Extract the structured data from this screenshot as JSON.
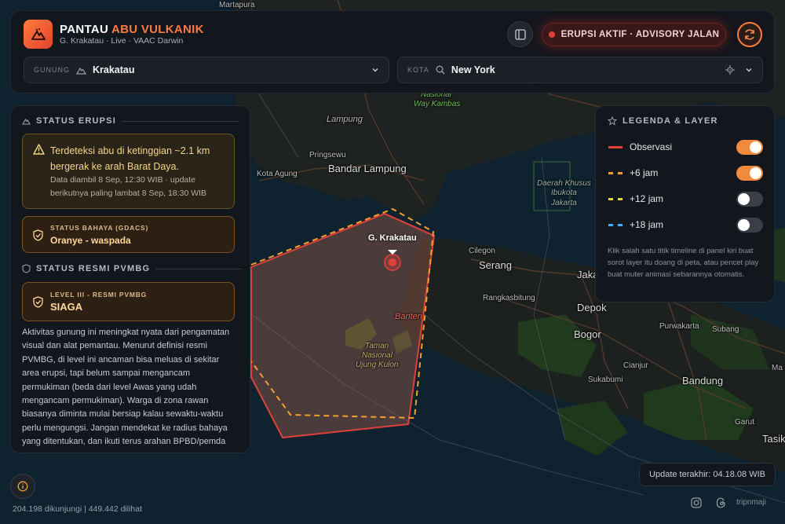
{
  "header": {
    "title_main": "PANTAU",
    "title_accent": "ABU VULKANIK",
    "subtitle": "G. Krakatau · Live · VAAC Darwin",
    "status_pill": "ERUPSI AKTIF · ADVISORY JALAN",
    "volcano_selector": {
      "label": "GUNUNG",
      "value": "Krakatau"
    },
    "city_selector": {
      "label": "KOTA",
      "value": "New York"
    }
  },
  "status_erupsi": {
    "title": "STATUS ERUPSI",
    "alert_main": "Terdeteksi abu di ketinggian ~2.1 km bergerak ke arah Barat Daya.",
    "alert_sub": "Data diambil 8 Sep, 12:30 WIB · update berikutnya paling lambat 8 Sep, 18:30 WIB",
    "gdacs_label": "STATUS BAHAYA (GDACS)",
    "gdacs_value": "Oranye - waspada"
  },
  "status_pvmbg": {
    "title": "STATUS RESMI PVMBG",
    "level_label": "LEVEL III - RESMI PVMBG",
    "level_value": "SIAGA",
    "description": "Aktivitas gunung ini meningkat nyata dari pengamatan visual dan alat pemantau. Menurut definisi resmi PVMBG, di level ini ancaman bisa meluas di sekitar area erupsi, tapi belum sampai mengancam permukiman (beda dari level Awas yang udah mengancam permukiman). Warga di zona rawan biasanya diminta mulai bersiap kalau sewaktu-waktu perlu mengungsi. Jangan mendekat ke radius bahaya yang ditentukan, dan ikuti terus arahan BPBD/pemda setempat."
  },
  "legend": {
    "title": "LEGENDA & LAYER",
    "items": [
      {
        "label": "Observasi",
        "color": "#e0403a",
        "style": "solid",
        "enabled": true
      },
      {
        "label": "+6 jam",
        "color": "#f0a030",
        "style": "dashed",
        "enabled": true
      },
      {
        "label": "+12 jam",
        "color": "#f2d23a",
        "style": "dashed",
        "enabled": false
      },
      {
        "label": "+18 jam",
        "color": "#4aa8f0",
        "style": "dashed",
        "enabled": false
      }
    ],
    "note": "Klik salah satu titik timeline di panel kiri buat sorot layer itu doang di peta, atau pencet play buat muter animasi sebarannya otomatis."
  },
  "map": {
    "volcano_marker": "G. Krakatau",
    "labels": {
      "martapura": "Martapura",
      "nasional": "Nasional",
      "way_kambas": "Way Kambas",
      "lampung": "Lampung",
      "pringsewu": "Pringsewu",
      "bandar_lampung": "Bandar Lampung",
      "kota_agung": "Kota Agung",
      "daerah_khusus": "Daerah Khusus",
      "ibukota": "Ibukota",
      "jakarta": "Jakarta",
      "cilegon": "Cilegon",
      "serang": "Serang",
      "jaka": "Jaka",
      "rangkasbitung": "Rangkasbitung",
      "depok": "Depok",
      "banten": "Banten",
      "bogor": "Bogor",
      "purwakarta": "Purwakarta",
      "subang": "Subang",
      "taman": "Taman",
      "nasional2": "Nasional",
      "ujung_kulon": "Ujung Kulon",
      "cianjur": "Cianjur",
      "sukabumi": "Sukabumi",
      "bandung": "Bandung",
      "ma": "Ma",
      "garut": "Garut",
      "tasik": "Tasik"
    }
  },
  "footer": {
    "visits": "204.198 dikunjungi | 449.442 dilihat",
    "last_update": "Update terakhir: 04.18.08 WIB",
    "brand": "tripnmaji"
  },
  "colors": {
    "accent": "#ff7a45",
    "danger": "#e0403a",
    "warning": "#f0a030"
  }
}
